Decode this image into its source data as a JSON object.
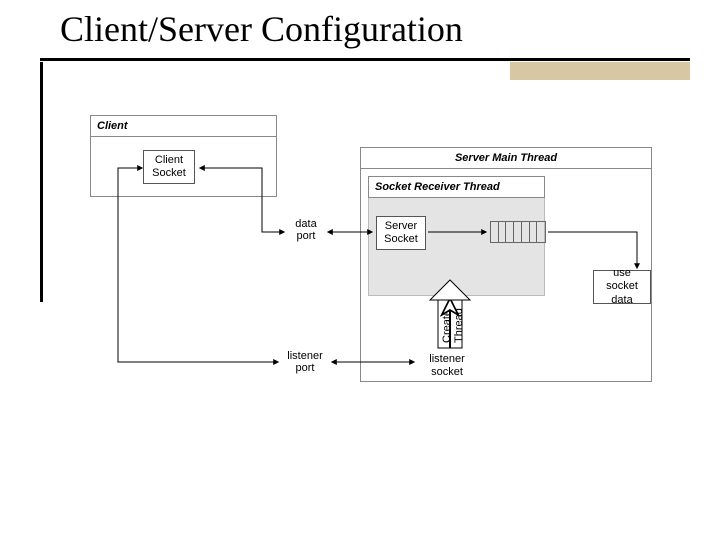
{
  "title": "Client/Server Configuration",
  "client": {
    "title": "Client",
    "socket": "Client\nSocket"
  },
  "labels": {
    "data_port": "data\nport",
    "listener_port": "listener\nport",
    "create_thread": "Create\nThread"
  },
  "server": {
    "main_thread_title": "Server Main Thread",
    "receiver_thread_title": "Socket Receiver Thread",
    "server_socket": "Server\nSocket",
    "listener_socket": "listener\nsocket",
    "use_socket_data": "use socket\ndata"
  }
}
